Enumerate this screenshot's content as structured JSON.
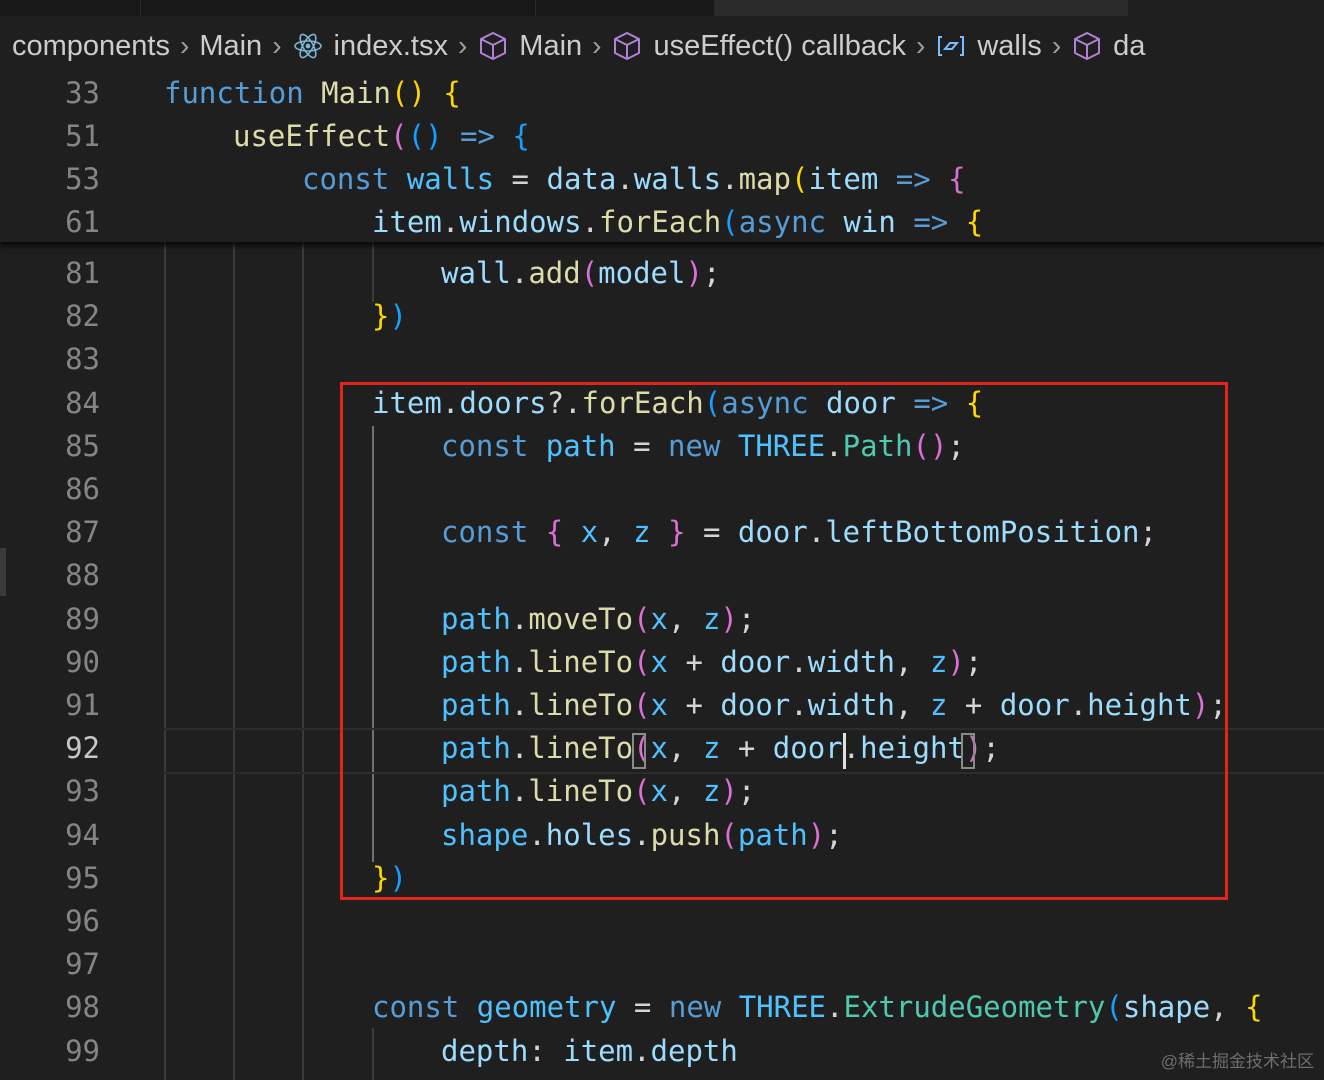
{
  "breadcrumb": {
    "items": [
      {
        "label": "components",
        "icon": null
      },
      {
        "label": "Main",
        "icon": null
      },
      {
        "label": "index.tsx",
        "icon": "react-icon"
      },
      {
        "label": "Main",
        "icon": "cube-icon"
      },
      {
        "label": "useEffect() callback",
        "icon": "cube-icon"
      },
      {
        "label": "walls",
        "icon": "variable-icon"
      },
      {
        "label": "da",
        "icon": "cube-icon"
      }
    ]
  },
  "editor": {
    "current_line": "92",
    "sticky_lines": [
      {
        "num": "33",
        "tokens": [
          [
            "kw",
            "function"
          ],
          [
            "op",
            " "
          ],
          [
            "fn",
            "Main"
          ],
          [
            "p1",
            "()"
          ],
          [
            "op",
            " "
          ],
          [
            "p1",
            "{"
          ]
        ]
      },
      {
        "num": "51",
        "tokens": [
          [
            "fn",
            "useEffect"
          ],
          [
            "p2",
            "("
          ],
          [
            "p3",
            "()"
          ],
          [
            "op",
            " "
          ],
          [
            "kw",
            "=>"
          ],
          [
            "op",
            " "
          ],
          [
            "p3",
            "{"
          ]
        ]
      },
      {
        "num": "53",
        "tokens": [
          [
            "kw",
            "const"
          ],
          [
            "op",
            " "
          ],
          [
            "cst",
            "walls"
          ],
          [
            "op",
            " = "
          ],
          [
            "var",
            "data"
          ],
          [
            "op",
            "."
          ],
          [
            "var",
            "walls"
          ],
          [
            "op",
            "."
          ],
          [
            "fn",
            "map"
          ],
          [
            "p1",
            "("
          ],
          [
            "var",
            "item"
          ],
          [
            "op",
            " "
          ],
          [
            "kw",
            "=>"
          ],
          [
            "op",
            " "
          ],
          [
            "p2",
            "{"
          ]
        ]
      },
      {
        "num": "61",
        "tokens": [
          [
            "var",
            "item"
          ],
          [
            "op",
            "."
          ],
          [
            "var",
            "windows"
          ],
          [
            "op",
            "."
          ],
          [
            "fn",
            "forEach"
          ],
          [
            "p3",
            "("
          ],
          [
            "kw",
            "async"
          ],
          [
            "op",
            " "
          ],
          [
            "var",
            "win"
          ],
          [
            "op",
            " "
          ],
          [
            "kw",
            "=>"
          ],
          [
            "op",
            " "
          ],
          [
            "p1",
            "{"
          ]
        ]
      }
    ],
    "lines": [
      {
        "num": "81",
        "tokens": [
          [
            "var",
            "wall"
          ],
          [
            "op",
            "."
          ],
          [
            "fn",
            "add"
          ],
          [
            "p2",
            "("
          ],
          [
            "var",
            "model"
          ],
          [
            "p2",
            ")"
          ],
          [
            "op",
            ";"
          ]
        ]
      },
      {
        "num": "82",
        "tokens": [
          [
            "p1",
            "}"
          ],
          [
            "p3",
            ")"
          ]
        ]
      },
      {
        "num": "83",
        "tokens": []
      },
      {
        "num": "84",
        "tokens": [
          [
            "var",
            "item"
          ],
          [
            "op",
            "."
          ],
          [
            "var",
            "doors"
          ],
          [
            "op",
            "?."
          ],
          [
            "fn",
            "forEach"
          ],
          [
            "p3",
            "("
          ],
          [
            "kw",
            "async"
          ],
          [
            "op",
            " "
          ],
          [
            "var",
            "door"
          ],
          [
            "op",
            " "
          ],
          [
            "kw",
            "=>"
          ],
          [
            "op",
            " "
          ],
          [
            "p1",
            "{"
          ]
        ]
      },
      {
        "num": "85",
        "tokens": [
          [
            "kw",
            "const"
          ],
          [
            "op",
            " "
          ],
          [
            "cst",
            "path"
          ],
          [
            "op",
            " = "
          ],
          [
            "kw",
            "new"
          ],
          [
            "op",
            " "
          ],
          [
            "cst",
            "THREE"
          ],
          [
            "op",
            "."
          ],
          [
            "cls",
            "Path"
          ],
          [
            "p2",
            "()"
          ],
          [
            "op",
            ";"
          ]
        ]
      },
      {
        "num": "86",
        "tokens": []
      },
      {
        "num": "87",
        "tokens": [
          [
            "kw",
            "const"
          ],
          [
            "op",
            " "
          ],
          [
            "p2",
            "{"
          ],
          [
            "op",
            " "
          ],
          [
            "cst",
            "x"
          ],
          [
            "op",
            ", "
          ],
          [
            "cst",
            "z"
          ],
          [
            "op",
            " "
          ],
          [
            "p2",
            "}"
          ],
          [
            "op",
            " = "
          ],
          [
            "var",
            "door"
          ],
          [
            "op",
            "."
          ],
          [
            "var",
            "leftBottomPosition"
          ],
          [
            "op",
            ";"
          ]
        ]
      },
      {
        "num": "88",
        "tokens": []
      },
      {
        "num": "89",
        "tokens": [
          [
            "cst",
            "path"
          ],
          [
            "op",
            "."
          ],
          [
            "fn",
            "moveTo"
          ],
          [
            "p2",
            "("
          ],
          [
            "cst",
            "x"
          ],
          [
            "op",
            ", "
          ],
          [
            "cst",
            "z"
          ],
          [
            "p2",
            ")"
          ],
          [
            "op",
            ";"
          ]
        ]
      },
      {
        "num": "90",
        "tokens": [
          [
            "cst",
            "path"
          ],
          [
            "op",
            "."
          ],
          [
            "fn",
            "lineTo"
          ],
          [
            "p2",
            "("
          ],
          [
            "cst",
            "x"
          ],
          [
            "op",
            " + "
          ],
          [
            "var",
            "door"
          ],
          [
            "op",
            "."
          ],
          [
            "var",
            "width"
          ],
          [
            "op",
            ", "
          ],
          [
            "cst",
            "z"
          ],
          [
            "p2",
            ")"
          ],
          [
            "op",
            ";"
          ]
        ]
      },
      {
        "num": "91",
        "tokens": [
          [
            "cst",
            "path"
          ],
          [
            "op",
            "."
          ],
          [
            "fn",
            "lineTo"
          ],
          [
            "p2",
            "("
          ],
          [
            "cst",
            "x"
          ],
          [
            "op",
            " + "
          ],
          [
            "var",
            "door"
          ],
          [
            "op",
            "."
          ],
          [
            "var",
            "width"
          ],
          [
            "op",
            ", "
          ],
          [
            "cst",
            "z"
          ],
          [
            "op",
            " + "
          ],
          [
            "var",
            "door"
          ],
          [
            "op",
            "."
          ],
          [
            "var",
            "height"
          ],
          [
            "p2",
            ")"
          ],
          [
            "op",
            ";"
          ]
        ]
      },
      {
        "num": "92",
        "tokens": [
          [
            "cst",
            "path"
          ],
          [
            "op",
            "."
          ],
          [
            "fn",
            "lineTo"
          ],
          [
            "p2",
            "("
          ],
          [
            "cst",
            "x"
          ],
          [
            "op",
            ", "
          ],
          [
            "cst",
            "z"
          ],
          [
            "op",
            " + "
          ],
          [
            "var",
            "door"
          ],
          [
            "op",
            "."
          ],
          [
            "var",
            "height"
          ],
          [
            "p2",
            ")"
          ],
          [
            "op",
            ";"
          ]
        ]
      },
      {
        "num": "93",
        "tokens": [
          [
            "cst",
            "path"
          ],
          [
            "op",
            "."
          ],
          [
            "fn",
            "lineTo"
          ],
          [
            "p2",
            "("
          ],
          [
            "cst",
            "x"
          ],
          [
            "op",
            ", "
          ],
          [
            "cst",
            "z"
          ],
          [
            "p2",
            ")"
          ],
          [
            "op",
            ";"
          ]
        ]
      },
      {
        "num": "94",
        "tokens": [
          [
            "cst",
            "shape"
          ],
          [
            "op",
            "."
          ],
          [
            "var",
            "holes"
          ],
          [
            "op",
            "."
          ],
          [
            "fn",
            "push"
          ],
          [
            "p2",
            "("
          ],
          [
            "cst",
            "path"
          ],
          [
            "p2",
            ")"
          ],
          [
            "op",
            ";"
          ]
        ]
      },
      {
        "num": "95",
        "tokens": [
          [
            "p1",
            "}"
          ],
          [
            "p3",
            ")"
          ]
        ]
      },
      {
        "num": "96",
        "tokens": []
      },
      {
        "num": "97",
        "tokens": []
      },
      {
        "num": "98",
        "tokens": [
          [
            "kw",
            "const"
          ],
          [
            "op",
            " "
          ],
          [
            "cst",
            "geometry"
          ],
          [
            "op",
            " = "
          ],
          [
            "kw",
            "new"
          ],
          [
            "op",
            " "
          ],
          [
            "cst",
            "THREE"
          ],
          [
            "op",
            "."
          ],
          [
            "cls",
            "ExtrudeGeometry"
          ],
          [
            "p3",
            "("
          ],
          [
            "var",
            "shape"
          ],
          [
            "op",
            ", "
          ],
          [
            "p1",
            "{"
          ]
        ]
      },
      {
        "num": "99",
        "tokens": [
          [
            "var",
            "depth"
          ],
          [
            "op",
            ": "
          ],
          [
            "var",
            "item"
          ],
          [
            "op",
            "."
          ],
          [
            "var",
            "depth"
          ]
        ]
      }
    ]
  },
  "watermark": "@稀土掘金技术社区"
}
